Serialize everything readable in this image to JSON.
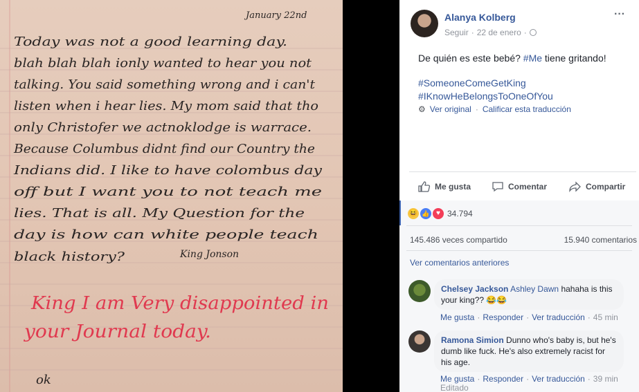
{
  "note": {
    "date": "January 22nd",
    "lines": [
      "Today was not a good learning day.",
      "blah blah blah ionly wanted to hear you not",
      "talking. You said something wrong and i can't",
      "listen when i hear lies. My mom said that tho",
      "only Christofer we actnoklodge is warrace.",
      "Because Columbus didnt find our Country the",
      "Indians did. I like to have colombus day",
      "off but I want you to not teach me",
      "lies. That is all. My Question for the",
      "day is how can white people teach",
      "black history?"
    ],
    "signature": "King Jonson",
    "teacher_line1": "King I am Very disappointed in",
    "teacher_line2": "your Journal today.",
    "reply": "ok"
  },
  "post": {
    "author": "Alanya Kolberg",
    "follow": "Seguir",
    "date": "22 de enero",
    "sep": "·",
    "more": "···",
    "text_prefix": "De quién es este bebé?",
    "text_hashtag": "#Me",
    "text_suffix": "tiene gritando!",
    "hashtag1": "#SomeoneComeGetKing",
    "hashtag2": "#IKnowHeBelongsToOneOfYou",
    "see_original": "Ver original",
    "rate_translation": "Calificar esta traducción",
    "like": "Me gusta",
    "comment": "Comentar",
    "share": "Compartir",
    "reactions_count": "34.794",
    "shares": "145.486 veces compartido",
    "comments_count": "15.940 comentarios",
    "view_previous": "Ver comentarios anteriores"
  },
  "comments": [
    {
      "name": "Chelsey Jackson",
      "tag": "Ashley Dawn",
      "text": "hahaha is this your king??",
      "emoji": "😂😂",
      "like": "Me gusta",
      "reply": "Responder",
      "translate": "Ver traducción",
      "time": "45 min"
    },
    {
      "name": "Ramona Simion",
      "text": "Dunno who's baby is, but he's dumb like fuck. He's also extremely racist for his age.",
      "like": "Me gusta",
      "reply": "Responder",
      "translate": "Ver traducción",
      "time": "39 min",
      "edited": "Editado"
    }
  ],
  "colors": {
    "link": "#365899",
    "muted": "#90949c",
    "paper": "#e4c9b8",
    "red_ink": "#e0394f",
    "love": "#f33e58",
    "like": "#4a7ef5"
  }
}
